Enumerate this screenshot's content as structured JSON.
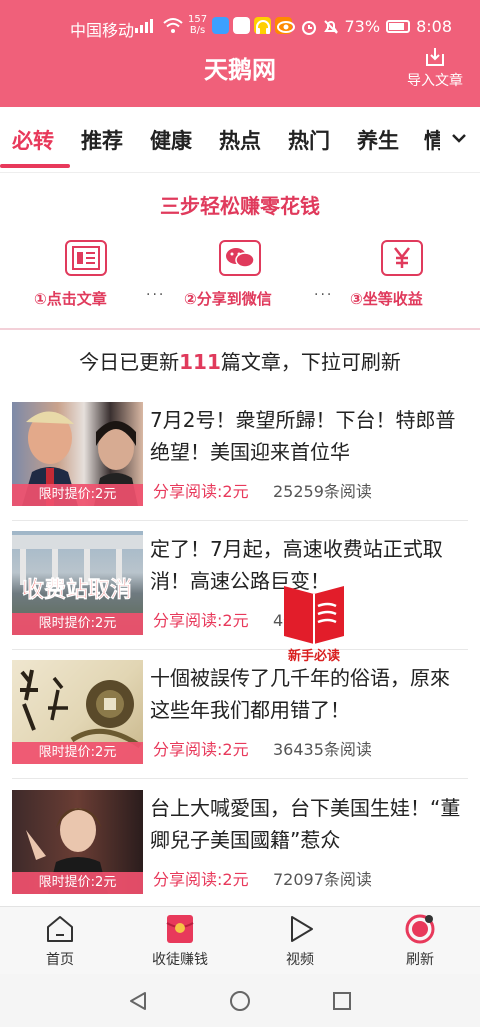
{
  "status": {
    "carrier": "中国移动",
    "net_speed_value": "157",
    "net_speed_unit": "B/s",
    "battery": "73%",
    "time": "8:08"
  },
  "header": {
    "title": "天鹅网",
    "import_label": "导入文章"
  },
  "tabs": [
    "必转",
    "推荐",
    "健康",
    "热点",
    "热门",
    "养生",
    "情"
  ],
  "promo": {
    "title": "三步轻松赚零花钱",
    "steps": [
      "①点击文章",
      "②分享到微信",
      "③坐等收益"
    ],
    "dots": "···"
  },
  "notice": {
    "prefix": "今日已更新",
    "count": "111",
    "suffix": "篇文章，下拉可刷新"
  },
  "articles": [
    {
      "headline": "7月2号！衆望所歸！下台！特郎普绝望！美国迎来首位华",
      "price": "限时提价:2元",
      "share": "分享阅读:2元",
      "reads": "25259条阅读"
    },
    {
      "headline": "定了！7月起，高速收费站正式取消！高速公路巨变！",
      "price": "限时提价:2元",
      "share": "分享阅读:2元",
      "reads": "4条阅读",
      "thumb_text": "收费站取消"
    },
    {
      "headline": "十個被誤传了几千年的俗语，原來这些年我们都用错了！",
      "price": "限时提价:2元",
      "share": "分享阅读:2元",
      "reads": "36435条阅读"
    },
    {
      "headline": "台上大喊愛国，台下美国生娃！“董卿兒子美国國籍”惹众",
      "price": "限时提价:2元",
      "share": "分享阅读:2元",
      "reads": "72097条阅读"
    }
  ],
  "badge": {
    "label": "新手必读"
  },
  "bottom_nav": [
    "首页",
    "收徒赚钱",
    "视频",
    "刷新"
  ],
  "colors": {
    "brand": "#f0607a",
    "accent": "#e8395b"
  },
  "icons": {
    "import": "import-icon",
    "more": "chevron-down-icon",
    "steps": [
      "article-icon",
      "wechat-icon",
      "yuan-icon"
    ],
    "nav": [
      "home-icon",
      "red-envelope-icon",
      "play-icon",
      "refresh-icon"
    ]
  }
}
